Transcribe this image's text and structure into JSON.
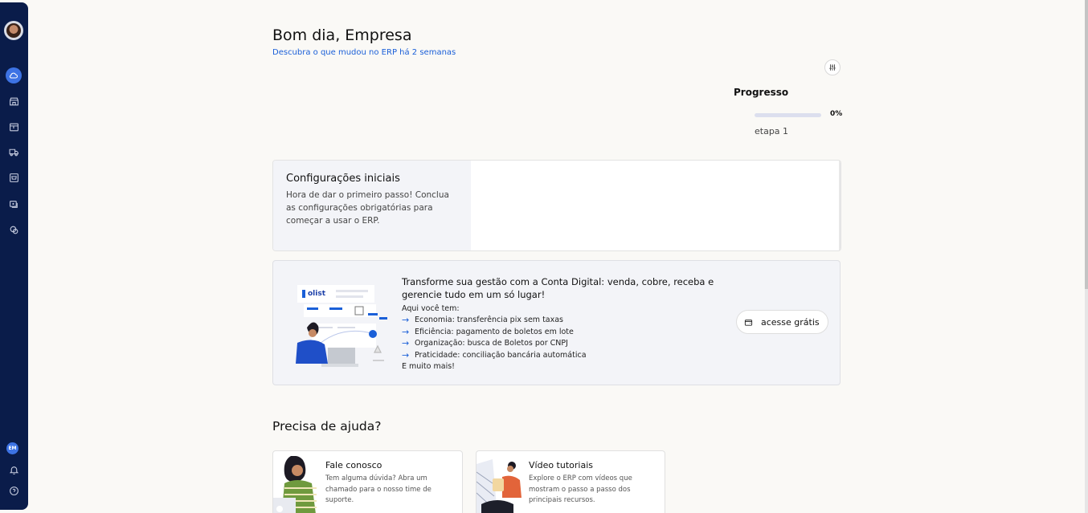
{
  "sidebar": {
    "user_initials": "EM"
  },
  "header": {
    "greeting": "Bom dia, Empresa",
    "changes_link": "Descubra o que mudou no ERP há 2 semanas"
  },
  "progress": {
    "title": "Progresso",
    "percent_label": "0%",
    "percent_value": 0,
    "step_label": "etapa 1"
  },
  "config": {
    "title": "Configurações iniciais",
    "description": "Hora de dar o primeiro passo! Conclua as configurações obrigatórias para começar a usar o ERP."
  },
  "promo": {
    "logo_text": "olist",
    "title": "Transforme sua gestão com a Conta Digital: venda, cobre, receba e gerencie tudo em um só lugar!",
    "subtitle": "Aqui você tem:",
    "items": [
      "Economia: transferência pix sem taxas",
      "Eficiência: pagamento de boletos em lote",
      "Organização: busca de Boletos por CNPJ",
      "Praticidade: conciliação bancária automática"
    ],
    "more": "E muito mais!",
    "button_label": "acesse grátis"
  },
  "help": {
    "title": "Precisa de ajuda?",
    "cards": [
      {
        "title": "Fale conosco",
        "description": "Tem alguma dúvida? Abra um chamado para o nosso time de suporte."
      },
      {
        "title": "Vídeo tutoriais",
        "description": "Explore o ERP com vídeos que mostram o passo a passo dos principais recursos."
      }
    ]
  },
  "colors": {
    "sidebar_bg": "#0a1c4a",
    "accent": "#3d73e4",
    "link": "#1a5fd8",
    "background": "#faf9f6"
  }
}
